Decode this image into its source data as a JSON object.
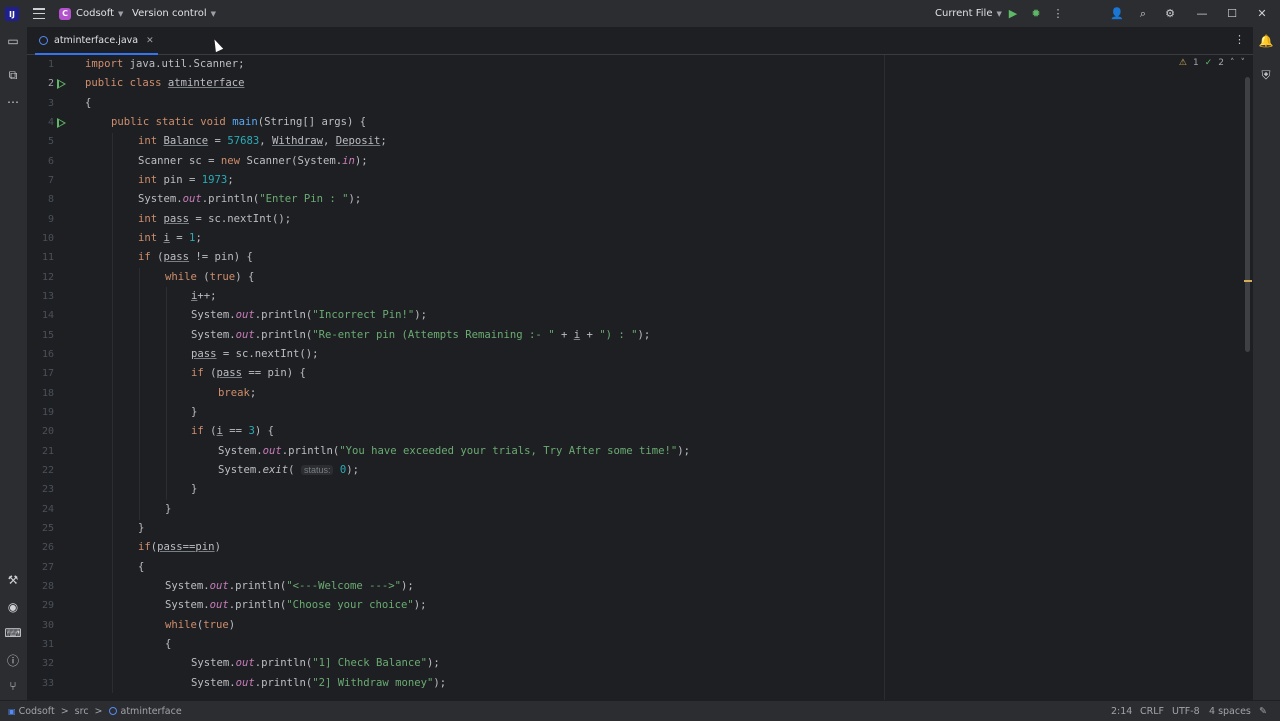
{
  "titlebar": {
    "project_badge": "C",
    "project_name": "Codsoft",
    "vcs_label": "Version control",
    "run_config": "Current File"
  },
  "tab": {
    "filename": "atminterface.java"
  },
  "inspections": {
    "warnings": "1",
    "checks": "2"
  },
  "code": {
    "lines": [
      {
        "n": "1"
      },
      {
        "n": "2"
      },
      {
        "n": "3"
      },
      {
        "n": "4"
      },
      {
        "n": "5"
      },
      {
        "n": "6"
      },
      {
        "n": "7"
      },
      {
        "n": "8"
      },
      {
        "n": "9"
      },
      {
        "n": "10"
      },
      {
        "n": "11"
      },
      {
        "n": "12"
      },
      {
        "n": "13"
      },
      {
        "n": "14"
      },
      {
        "n": "15"
      },
      {
        "n": "16"
      },
      {
        "n": "17"
      },
      {
        "n": "18"
      },
      {
        "n": "19"
      },
      {
        "n": "20"
      },
      {
        "n": "21"
      },
      {
        "n": "22"
      },
      {
        "n": "23"
      },
      {
        "n": "24"
      },
      {
        "n": "25"
      },
      {
        "n": "26"
      },
      {
        "n": "27"
      },
      {
        "n": "28"
      },
      {
        "n": "29"
      },
      {
        "n": "30"
      },
      {
        "n": "31"
      },
      {
        "n": "32"
      },
      {
        "n": "33"
      }
    ],
    "t": {
      "l1a": "import",
      "l1b": " java.util.Scanner;",
      "l2a": "public class ",
      "l2b": "atminterface",
      "l3": "{",
      "l4a": "public static void ",
      "l4b": "main",
      "l4c": "(String[] args) {",
      "l5a": "int ",
      "l5b": "Balance",
      "l5c": " = ",
      "l5d": "57683",
      "l5e": ", ",
      "l5f": "Withdraw",
      "l5g": ", ",
      "l5h": "Deposit",
      "l5i": ";",
      "l6a": "Scanner sc = ",
      "l6b": "new ",
      "l6c": "Scanner(System.",
      "l6d": "in",
      "l6e": ");",
      "l7a": "int ",
      "l7b": "pin = ",
      "l7c": "1973",
      "l7d": ";",
      "l8a": "System.",
      "l8b": "out",
      "l8c": ".println(",
      "l8d": "\"Enter Pin : \"",
      "l8e": ");",
      "l9a": "int ",
      "l9b": "pass",
      "l9c": " = sc.nextInt();",
      "l10a": "int ",
      "l10b": "i",
      "l10c": " = ",
      "l10d": "1",
      "l10e": ";",
      "l11a": "if ",
      "l11b": "(",
      "l11c": "pass",
      "l11d": " != pin) {",
      "l12a": "while ",
      "l12b": "(",
      "l12c": "true",
      "l12d": ") {",
      "l13a": "i",
      "l13b": "++;",
      "l14a": "System.",
      "l14b": "out",
      "l14c": ".println(",
      "l14d": "\"Incorrect Pin!\"",
      "l14e": ");",
      "l15a": "System.",
      "l15b": "out",
      "l15c": ".println(",
      "l15d": "\"Re-enter pin (Attempts Remaining :- \"",
      "l15e": " + ",
      "l15f": "i",
      "l15g": " + ",
      "l15h": "\") : \"",
      "l15i": ");",
      "l16a": "pass",
      "l16b": " = sc.nextInt();",
      "l17a": "if ",
      "l17b": "(",
      "l17c": "pass",
      "l17d": " == pin) {",
      "l18a": "break",
      "l18b": ";",
      "l19": "}",
      "l20a": "if ",
      "l20b": "(",
      "l20c": "i",
      "l20d": " == ",
      "l20e": "3",
      "l20f": ") {",
      "l21a": "System.",
      "l21b": "out",
      "l21c": ".println(",
      "l21d": "\"You have exceeded your trials, Try After some time!\"",
      "l21e": ");",
      "l22a": "System.",
      "l22b": "exit",
      "l22c": "( ",
      "l22d": "status:",
      "l22e": " 0",
      "l22f": ");",
      "l23": "}",
      "l24": "}",
      "l25": "}",
      "l26a": "if",
      "l26b": "(",
      "l26c": "pass==pin",
      "l26d": ")",
      "l27": "{",
      "l28a": "System.",
      "l28b": "out",
      "l28c": ".println(",
      "l28d": "\"<---Welcome --->\"",
      "l28e": ");",
      "l29a": "System.",
      "l29b": "out",
      "l29c": ".println(",
      "l29d": "\"Choose your choice\"",
      "l29e": ");",
      "l30a": "while",
      "l30b": "(",
      "l30c": "true",
      "l30d": ")",
      "l31": "{",
      "l32a": "System.",
      "l32b": "out",
      "l32c": ".println(",
      "l32d": "\"1] Check Balance\"",
      "l32e": ");",
      "l33a": "System.",
      "l33b": "out",
      "l33c": ".println(",
      "l33d": "\"2] Withdraw money\"",
      "l33e": ");"
    }
  },
  "statusbar": {
    "crumb_project": "Codsoft",
    "crumb_sep1": ">",
    "crumb_folder": "src",
    "crumb_sep2": ">",
    "crumb_class": "atminterface",
    "position": "2:14",
    "line_ending": "CRLF",
    "encoding": "UTF-8",
    "indent": "4 spaces"
  },
  "colors": {
    "accent": "#3574f0",
    "keyword": "#cf8e6d",
    "string": "#6aab73",
    "number": "#2aacb8",
    "function": "#56a8f5",
    "static": "#c77dbb"
  }
}
